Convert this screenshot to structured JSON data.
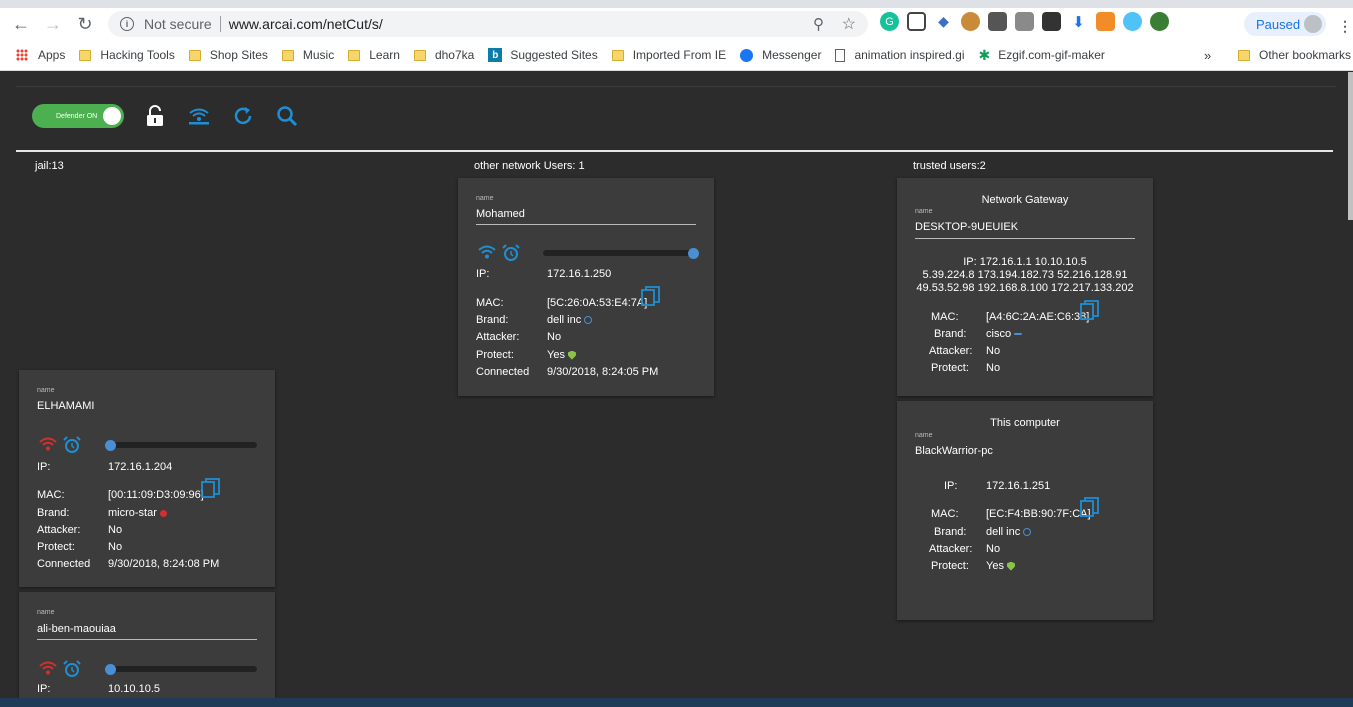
{
  "browser": {
    "security_text": "Not secure",
    "url": "www.arcai.com/netCut/s/",
    "paused_label": "Paused",
    "bookmarks": [
      {
        "label": "Apps",
        "icon": "apps-icon"
      },
      {
        "label": "Hacking Tools",
        "icon": "folder-icon"
      },
      {
        "label": "Shop Sites",
        "icon": "folder-icon"
      },
      {
        "label": "Music",
        "icon": "folder-icon"
      },
      {
        "label": "Learn",
        "icon": "folder-icon"
      },
      {
        "label": "dho7ka",
        "icon": "folder-icon"
      },
      {
        "label": "Suggested Sites",
        "icon": "bing-icon"
      },
      {
        "label": "Imported From IE",
        "icon": "folder-icon"
      },
      {
        "label": "Messenger",
        "icon": "messenger-icon"
      },
      {
        "label": "animation inspired.gi",
        "icon": "page-icon"
      },
      {
        "label": "Ezgif.com-gif-maker",
        "icon": "ezgif-icon"
      }
    ],
    "more_label": "»",
    "other_bookmarks": "Other bookmarks"
  },
  "toolbar": {
    "defender_label": "Defender ON",
    "accent": "#1e8fd4",
    "toggle_color": "#4caf50"
  },
  "columns": {
    "jail": "jail:13",
    "other": "other network Users: 1",
    "trusted": "trusted users:2"
  },
  "labels": {
    "name": "name",
    "ip": "IP:",
    "mac": "MAC:",
    "brand": "Brand:",
    "attacker": "Attacker:",
    "protect": "Protect:",
    "connected": "Connected"
  },
  "jail_cards": [
    {
      "name": "ELHAMAMI",
      "ip": "172.16.1.204",
      "mac": "[00:11:09:D3:09:96]",
      "brand": "micro-star",
      "attacker": "No",
      "protect": "No",
      "connected": "9/30/2018, 8:24:08 PM",
      "speed": 0
    },
    {
      "name": "ali-ben-maouiaa",
      "ip": "10.10.10.5",
      "speed": 0
    }
  ],
  "other_cards": [
    {
      "name": "Mohamed",
      "ip": "172.16.1.250",
      "mac": "[5C:26:0A:53:E4:7A]",
      "brand": "dell inc",
      "attacker": "No",
      "protect": "Yes",
      "connected": "9/30/2018, 8:24:05 PM",
      "speed": 1
    }
  ],
  "trusted_cards": [
    {
      "heading": "Network Gateway",
      "name": "DESKTOP-9UEUIEK",
      "ip_lines": [
        "IP:      172.16.1.1 10.10.10.5",
        "5.39.224.8 173.194.182.73 52.216.128.91",
        "49.53.52.98 192.168.8.100 172.217.133.202"
      ],
      "mac": "[A4:6C:2A:AE:C6:38]",
      "brand": "cisco",
      "attacker": "No",
      "protect": "No"
    },
    {
      "heading": "This computer",
      "name": "BlackWarrior-pc",
      "ip": "172.16.1.251",
      "mac": "[EC:F4:BB:90:7F:CA]",
      "brand": "dell inc",
      "attacker": "No",
      "protect": "Yes"
    }
  ]
}
